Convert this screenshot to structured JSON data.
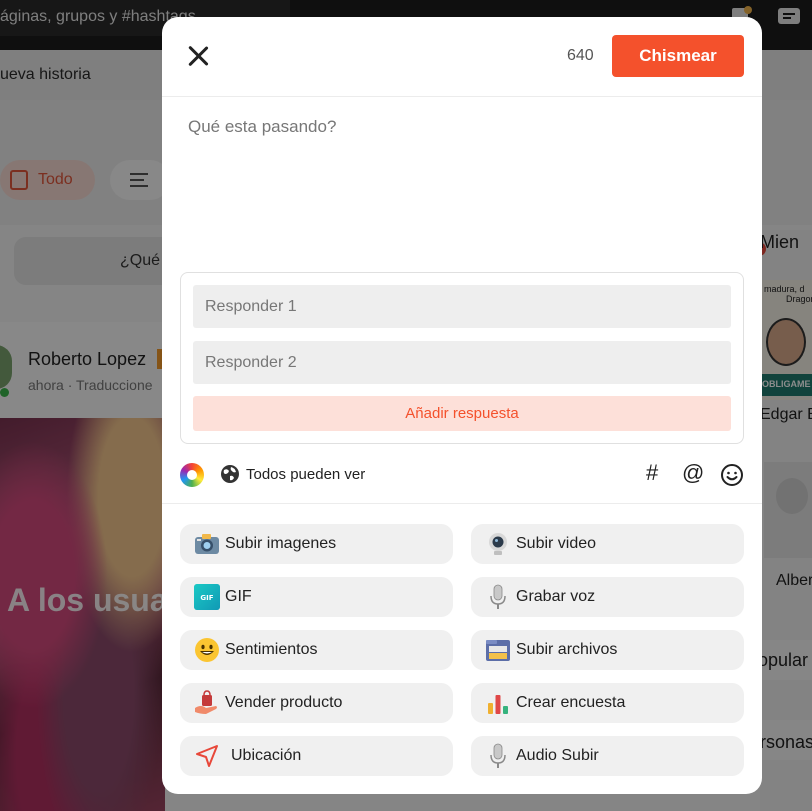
{
  "background": {
    "search_text": "áginas, grupos y #hashtags",
    "story_text": "ueva historia",
    "filter_todo": "Todo",
    "ask_text": "¿Qué",
    "post_author": "Roberto Lopez",
    "post_meta": "ahora · Traduccione",
    "post_image_text": "A los usua",
    "right_heading": "Mien",
    "right_thumb_line1": "madura, d",
    "right_thumb_line2": "Dragon B",
    "right_thumb_caption": "OBLIGAME D",
    "right_name_1": "Edgar B",
    "right_name_2": "Alber",
    "right_popular": "opular",
    "right_personas": "rsonas"
  },
  "modal": {
    "char_count": "640",
    "submit_label": "Chismear",
    "post_placeholder": "Qué esta pasando?",
    "poll": {
      "answer1_placeholder": "Responder 1",
      "answer2_placeholder": "Responder 2",
      "add_answer_label": "Añadir respuesta"
    },
    "privacy_label": "Todos pueden ver",
    "hashtag_symbol": "#",
    "mention_symbol": "@",
    "actions": [
      {
        "label": "Subir imagenes",
        "icon": "camera-icon"
      },
      {
        "label": "Subir video",
        "icon": "webcam-icon"
      },
      {
        "label": "GIF",
        "icon": "gif-icon"
      },
      {
        "label": "Grabar voz",
        "icon": "microphone-icon"
      },
      {
        "label": "Sentimientos",
        "icon": "emoji-grin-icon"
      },
      {
        "label": "Subir archivos",
        "icon": "folder-icon"
      },
      {
        "label": "Vender producto",
        "icon": "shopping-bag-icon"
      },
      {
        "label": "Crear encuesta",
        "icon": "bar-chart-icon"
      },
      {
        "label": "Ubicación",
        "icon": "location-arrow-icon"
      },
      {
        "label": "Audio Subir",
        "icon": "microphone-icon"
      }
    ],
    "accent_color": "#f4512c"
  }
}
